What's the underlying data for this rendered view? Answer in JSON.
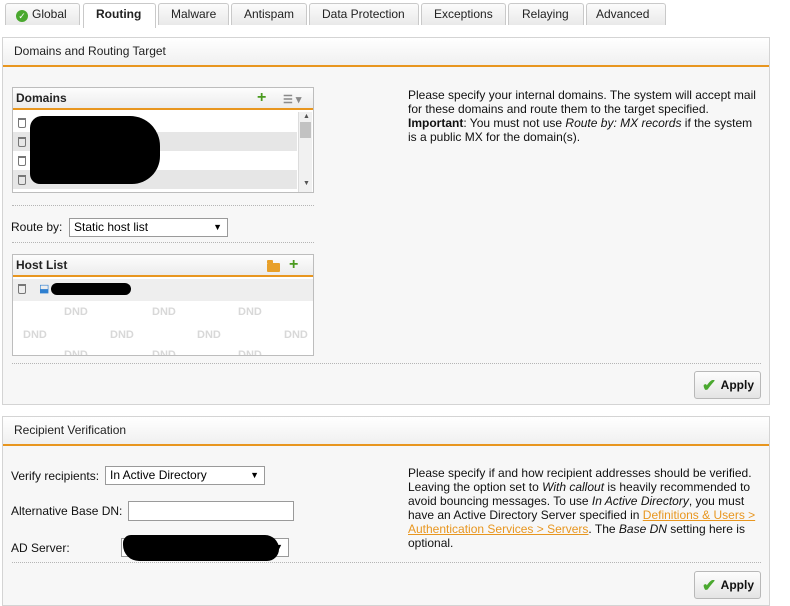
{
  "tabs": [
    {
      "label": "Global",
      "status": "ok"
    },
    {
      "label": "Routing",
      "active": true
    },
    {
      "label": "Malware"
    },
    {
      "label": "Antispam"
    },
    {
      "label": "Data Protection"
    },
    {
      "label": "Exceptions"
    },
    {
      "label": "Relaying"
    },
    {
      "label": "Advanced"
    }
  ],
  "routing": {
    "title": "Domains and Routing Target",
    "domains_header": "Domains",
    "route_by_label": "Route by:",
    "route_by_value": "Static host list",
    "host_list_header": "Host List",
    "dnd_text": "DND",
    "help_line1": "Please specify your internal domains. The system will accept mail",
    "help_line2": "for these domains and route them to the target specified.",
    "help_important": "Important",
    "help_line3a": ": You must not use ",
    "help_line3b": "Route by: MX records",
    "help_line3c": " if the system",
    "help_line4": "is a public MX for the domain(s).",
    "apply_label": "Apply"
  },
  "verification": {
    "title": "Recipient Verification",
    "verify_label": "Verify recipients:",
    "verify_value": "In Active Directory",
    "base_dn_label": "Alternative Base DN:",
    "base_dn_value": "",
    "ad_server_label": "AD Server:",
    "help_l1": "Please specify if and how recipient addresses should be verified.",
    "help_l2a": "Leaving the option set to ",
    "help_l2b": "With callout",
    "help_l2c": " is heavily recommended to",
    "help_l3a": "avoid bouncing messages. To use ",
    "help_l3b": "In Active Directory",
    "help_l3c": ", you must",
    "help_l4a": "have an Active Directory Server specified in ",
    "help_link1": "Definitions & Users >",
    "help_link2": "Authentication Services > Servers",
    "help_l5b": ". The ",
    "help_l5c": "Base DN",
    "help_l5d": " setting here is",
    "help_l6": "optional.",
    "apply_label": "Apply"
  },
  "colors": {
    "accent": "#e8961f",
    "ok": "#4aa82f",
    "add": "#4a9a1e"
  }
}
